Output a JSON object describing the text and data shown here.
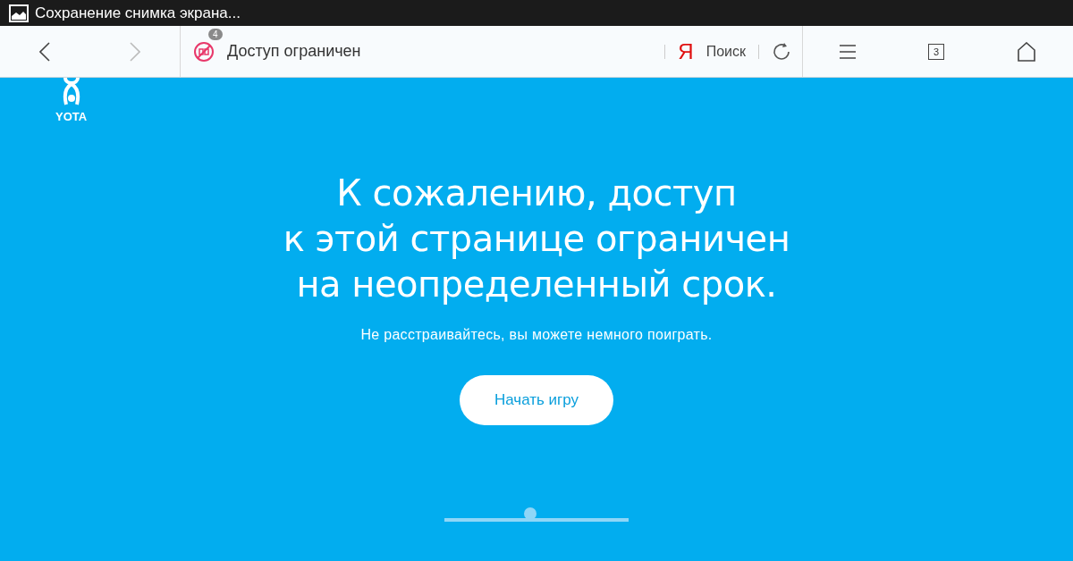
{
  "status_bar": {
    "notification": "Сохранение снимка экрана..."
  },
  "toolbar": {
    "page_title": "Доступ ограничен",
    "adblock_count": "4",
    "search_logo": "Я",
    "search_label": "Поиск",
    "tabs_count": "3"
  },
  "page": {
    "logo": "YOTA",
    "heading": [
      "К сожалению, доступ",
      "к этой странице ограничен",
      "на неопределенный срок."
    ],
    "subtitle": "Не расстраивайтесь, вы можете немного поиграть.",
    "button": "Начать игру"
  }
}
